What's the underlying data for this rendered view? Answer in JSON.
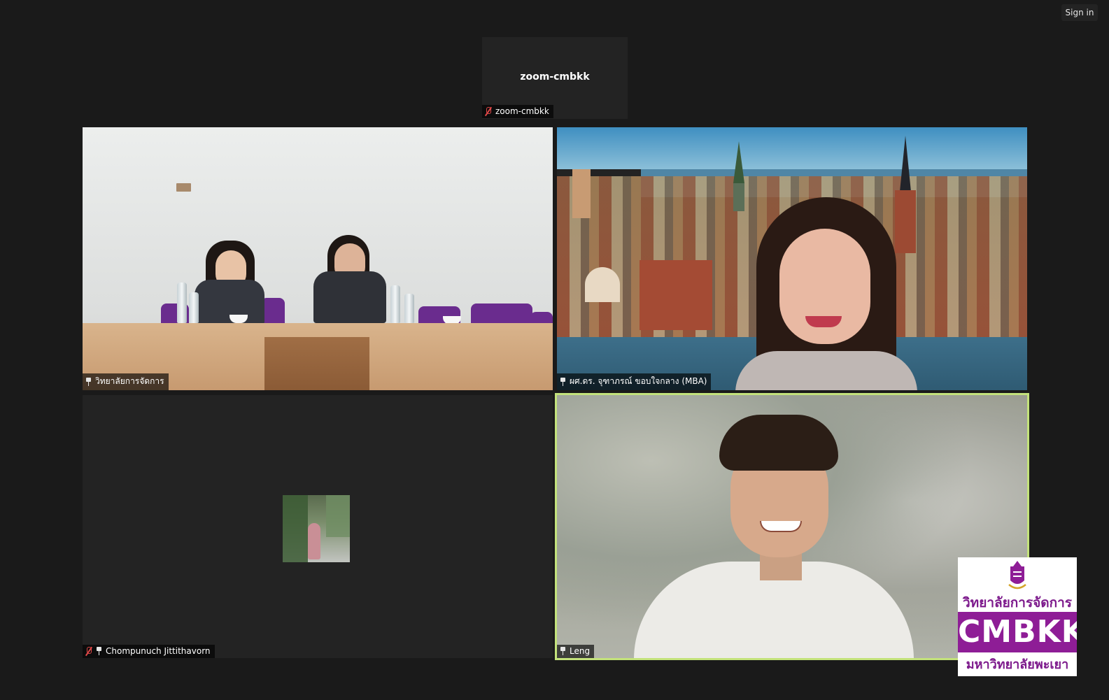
{
  "header": {
    "sign_in_label": "Sign in"
  },
  "top_participant": {
    "display_name": "zoom-cmbkk",
    "name_tag": "zoom-cmbkk",
    "muted": true
  },
  "participants": [
    {
      "name": "วิทยาลัยการจัดการ",
      "pinned": true,
      "muted": false,
      "speaking": false
    },
    {
      "name": "ผศ.ดร. จุฑาภรณ์ ขอบใจกลาง (MBA)",
      "pinned": true,
      "muted": false,
      "speaking": false
    },
    {
      "name": "Chompunuch Jittithavorn",
      "pinned": true,
      "muted": true,
      "speaking": false
    },
    {
      "name": "Leng",
      "pinned": true,
      "muted": false,
      "speaking": true
    }
  ],
  "logo": {
    "line_top": "วิทยาลัยการจัดการ",
    "brand": "CMBKK",
    "line_bottom": "มหาวิทยาลัยพะเยา",
    "brand_color": "#8e1d96"
  },
  "colors": {
    "background": "#1a1a1a",
    "tile": "#232323",
    "active_speaker_border": "#c3e27b",
    "muted_icon": "#e04848"
  }
}
